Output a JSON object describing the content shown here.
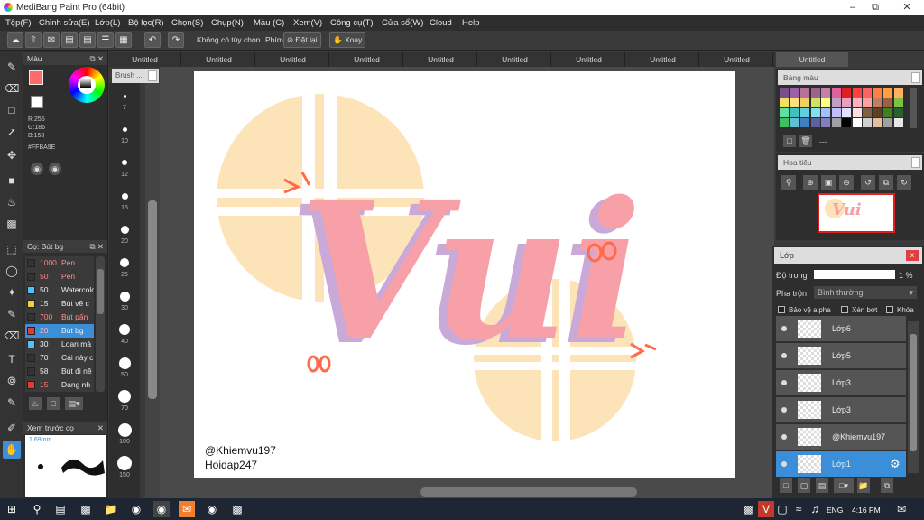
{
  "window": {
    "title": "MediBang Paint Pro (64bit)"
  },
  "menu": [
    "Tệp(F)",
    "Chỉnh sửa(E)",
    "Lớp(L)",
    "Bộ lọc(R)",
    "Chọn(S)",
    "Chụp(N)",
    "Màu (C)",
    "Xem(V)",
    "Công cụ(T)",
    "Cửa sổ(W)",
    "Cloud",
    "Help"
  ],
  "toolbar": {
    "no_option_label": "Không có tùy chọn",
    "key_label": "Phím",
    "reset_label": "Đặt lại",
    "rotate_label": "Xoay"
  },
  "color_panel": {
    "title": "Màu",
    "r": "R:255",
    "g": "G:186",
    "b": "B:158",
    "hex": "#FFBA9E",
    "fg_color": "#FF6A6A",
    "bg_color": "#3b8fd9"
  },
  "brush_panel": {
    "title": "Cọ: Bút bg",
    "items": [
      {
        "size": "1000",
        "name": "Pen",
        "color": "#333333"
      },
      {
        "size": "50",
        "name": "Pen",
        "color": "#333333"
      },
      {
        "size": "50",
        "name": "Watercolor",
        "color": "#4fc3f7"
      },
      {
        "size": "15",
        "name": "Bút vẽ c",
        "color": "#f4d03f"
      },
      {
        "size": "700",
        "name": "Bút pấn",
        "color": "#333333"
      },
      {
        "size": "20",
        "name": "Bút bg",
        "color": "#e53935"
      },
      {
        "size": "30",
        "name": "Loan mà",
        "color": "#4fc3f7"
      },
      {
        "size": "70",
        "name": "Cái này c",
        "color": "#333333"
      },
      {
        "size": "58",
        "name": "Bút đi nê",
        "color": "#333333"
      },
      {
        "size": "15",
        "name": "Dạng nh",
        "color": "#e53935"
      }
    ]
  },
  "preview_panel": {
    "title": "Xem trước cọ",
    "size_label": "1.69mm"
  },
  "brush_sizes": {
    "header": "Brush ...",
    "items": [
      "7",
      "10",
      "12",
      "15",
      "20",
      "25",
      "30",
      "40",
      "50",
      "70",
      "100",
      "150"
    ]
  },
  "tabs": [
    "Untitled",
    "Untitled",
    "Untitled",
    "Untitled",
    "Untitled",
    "Untitled",
    "Untitled",
    "Untitled",
    "Untitled",
    "Untitled"
  ],
  "canvas": {
    "artwork_text": "Vui",
    "watermark_line1": "@Khiemvu197",
    "watermark_line2": "Hoidap247"
  },
  "palette_panel": {
    "title": "Bảng màu",
    "dash": "---",
    "swatches": [
      "#7b4f8a",
      "#9c5fa8",
      "#b5739c",
      "#a06090",
      "#c47faa",
      "#e060a0",
      "#e02020",
      "#ff4040",
      "#ff6060",
      "#ff8040",
      "#ffa040",
      "#ffb060",
      "#f0e060",
      "#ffe080",
      "#f0d060",
      "#d0e060",
      "#ffff80",
      "#c0a0c0",
      "#e8a0c0",
      "#ffb0c0",
      "#ffa0a0",
      "#c08060",
      "#a06040",
      "#80c040",
      "#60e0a0",
      "#40c0c0",
      "#60d0e0",
      "#80e0f0",
      "#a0c0ff",
      "#c0c0ff",
      "#e0e0ff",
      "#ffe0e0",
      "#806040",
      "#604020",
      "#408020",
      "#2a6030",
      "#40c060",
      "#60c0d0",
      "#4080c0",
      "#6060a0",
      "#8080c0",
      "#a0a0a0",
      "#000000",
      "#ffffff",
      "#d0d0d0",
      "#e0c0a0",
      "#a0a0a0",
      "#e8e8e8"
    ]
  },
  "nav_panel": {
    "title": "Hoa tiêu"
  },
  "layer_panel": {
    "title": "Lớp",
    "opacity_label": "Độ trong",
    "opacity_value": "1 %",
    "blend_label": "Pha trộn",
    "blend_value": "Bình thường",
    "protect_alpha": "Bảo vệ alpha",
    "clip": "Xén bớt",
    "lock": "Khóa",
    "layers": [
      {
        "name": "Lớp6"
      },
      {
        "name": "Lớp5"
      },
      {
        "name": "Lớp3"
      },
      {
        "name": "Lớp3"
      },
      {
        "name": "@Khiemvu197"
      },
      {
        "name": "Lớp1"
      }
    ]
  },
  "taskbar": {
    "language": "ENG",
    "time": "4:16 PM"
  }
}
